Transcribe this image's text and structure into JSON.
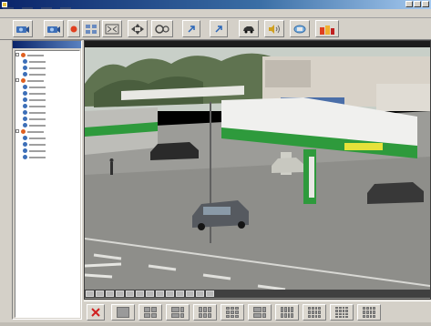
{
  "window": {
    "title": ""
  },
  "menu": [
    {
      "label": ""
    },
    {
      "label": ""
    },
    {
      "label": ""
    },
    {
      "label": ""
    }
  ],
  "toolbar": {
    "buttons": [
      {
        "icon": "camera-icon"
      },
      {
        "icon": "camera-icon"
      },
      {
        "icon": "record-icon"
      },
      {
        "icon": "layout-icon"
      },
      {
        "icon": "fullscreen-icon"
      },
      {
        "icon": "ptz-icon"
      },
      {
        "icon": "zoom-icon"
      },
      {
        "icon": "arrow-icon"
      },
      {
        "icon": "arrow-icon"
      },
      {
        "icon": "car-icon"
      },
      {
        "icon": "audio-icon"
      },
      {
        "icon": "network-icon"
      },
      {
        "icon": "users-icon"
      }
    ]
  },
  "left_panel": {
    "header": "",
    "tree": [
      {
        "label": "",
        "level": 0
      },
      {
        "label": "",
        "level": 1
      },
      {
        "label": "",
        "level": 1
      },
      {
        "label": "",
        "level": 1
      },
      {
        "label": "",
        "level": 0
      },
      {
        "label": "",
        "level": 1
      },
      {
        "label": "",
        "level": 1
      },
      {
        "label": "",
        "level": 1
      },
      {
        "label": "",
        "level": 1
      },
      {
        "label": "",
        "level": 1
      },
      {
        "label": "",
        "level": 1
      },
      {
        "label": "",
        "level": 1
      },
      {
        "label": "",
        "level": 0
      },
      {
        "label": "",
        "level": 1
      },
      {
        "label": "",
        "level": 1
      },
      {
        "label": "",
        "level": 1
      },
      {
        "label": "",
        "level": 1
      }
    ]
  },
  "viewer": {
    "header": "",
    "scene": "fuel-station-forecourt-camera-feed"
  },
  "bottom_bar": {
    "buttons": [
      {
        "icon": "close-icon"
      },
      {
        "icon": "layout-1x1-icon"
      },
      {
        "icon": "layout-2x2-icon"
      },
      {
        "icon": "layout-2x2-icon"
      },
      {
        "icon": "layout-3x3-icon"
      },
      {
        "icon": "layout-3x3-icon"
      },
      {
        "icon": "layout-3x3-icon"
      },
      {
        "icon": "layout-4x4-icon"
      },
      {
        "icon": "layout-4x4-icon"
      },
      {
        "icon": "layout-4x4-icon"
      },
      {
        "icon": "layout-4x4-icon"
      }
    ]
  },
  "colors": {
    "canopy": "#2e9a3c",
    "title_bar": "#0a246a",
    "toolbar": "#d4d0c8",
    "record_red": "#e04020"
  }
}
